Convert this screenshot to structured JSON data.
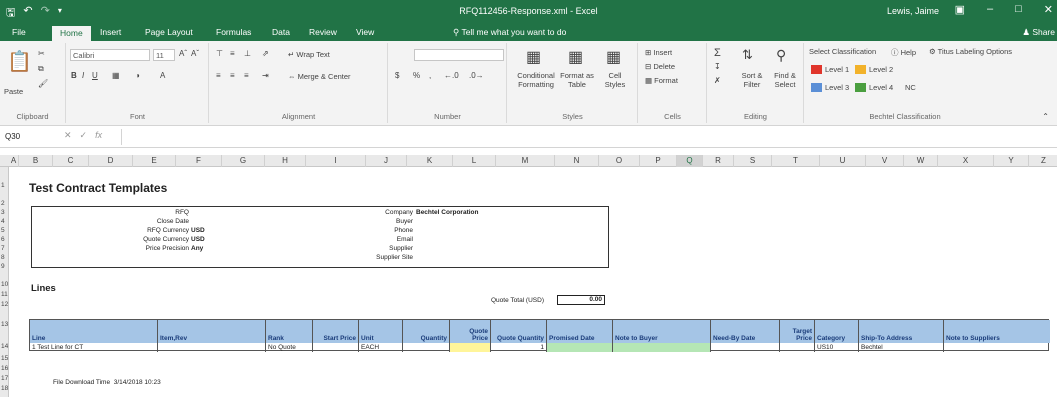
{
  "window": {
    "title": "RFQ112456-Response.xml - Excel",
    "user": "Lewis, Jaime",
    "qat_icons": [
      "save-icon",
      "undo-icon",
      "redo-icon",
      "customize-qat-icon"
    ],
    "controls": [
      "ribbon-display-icon",
      "minimize-icon",
      "maximize-icon",
      "close-icon"
    ]
  },
  "tabs": [
    "File",
    "Home",
    "Insert",
    "Page Layout",
    "Formulas",
    "Data",
    "Review",
    "View"
  ],
  "active_tab": "Home",
  "tell_me": "Tell me what you want to do",
  "share": "Share",
  "ribbon": {
    "clipboard": {
      "label": "Clipboard",
      "paste": "Paste"
    },
    "font": {
      "label": "Font",
      "name": "Calibri",
      "size": "11"
    },
    "alignment": {
      "label": "Alignment",
      "wrap": "Wrap Text",
      "merge": "Merge & Center"
    },
    "number": {
      "label": "Number",
      "format": "",
      "currency": "$",
      "percent": "%",
      "comma": ","
    },
    "styles": {
      "label": "Styles",
      "conditional": "Conditional Formatting",
      "format_table": "Format as Table",
      "cell_styles": "Cell Styles"
    },
    "cells": {
      "label": "Cells",
      "insert": "Insert",
      "delete": "Delete",
      "format": "Format"
    },
    "editing": {
      "label": "Editing",
      "sort": "Sort & Filter",
      "find": "Find & Select"
    },
    "classification": {
      "label": "Bechtel Classification",
      "select": "Select Classification",
      "help": "Help",
      "titus": "Titus Labeling Options",
      "levels": [
        {
          "name": "Level 1",
          "color": "#e0352b"
        },
        {
          "name": "Level 2",
          "color": "#f2b22a"
        },
        {
          "name": "Level 3",
          "color": "#5b8fd6"
        },
        {
          "name": "Level 4",
          "color": "#4a9e3f"
        },
        {
          "name": "NC",
          "color": ""
        }
      ]
    }
  },
  "formula_bar": {
    "name_box": "Q30",
    "formula": ""
  },
  "columns": [
    "A",
    "B",
    "C",
    "D",
    "E",
    "F",
    "G",
    "H",
    "I",
    "J",
    "K",
    "L",
    "M",
    "N",
    "O",
    "P",
    "Q",
    "R",
    "S",
    "T",
    "U",
    "V",
    "W",
    "X",
    "Y",
    "Z"
  ],
  "selected_column": "Q",
  "rows": [
    "1",
    "2",
    "3",
    "4",
    "5",
    "6",
    "7",
    "8",
    "9",
    "10",
    "11",
    "12",
    "13",
    "14",
    "15",
    "16",
    "17",
    "18"
  ],
  "sheet": {
    "title": "Test Contract Templates",
    "header_left": [
      {
        "label": "RFQ",
        "value": ""
      },
      {
        "label": "Close Date",
        "value": ""
      },
      {
        "label": "RFQ Currency",
        "value": "USD"
      },
      {
        "label": "Quote Currency",
        "value": "USD"
      },
      {
        "label": "Price Precision",
        "value": "Any"
      }
    ],
    "header_right": [
      {
        "label": "Company",
        "value": "Bechtel Corporation"
      },
      {
        "label": "Buyer",
        "value": ""
      },
      {
        "label": "Phone",
        "value": ""
      },
      {
        "label": "Email",
        "value": ""
      },
      {
        "label": "Supplier",
        "value": ""
      },
      {
        "label": "Supplier Site",
        "value": ""
      }
    ],
    "lines_title": "Lines",
    "quote_total_label": "Quote Total (USD)",
    "quote_total_value": "0.00",
    "table_headers": [
      "Line",
      "Item,Rev",
      "Rank",
      "Start Price",
      "Unit",
      "Quantity",
      "Quote Price",
      "Quote Quantity",
      "Promised Date",
      "Note to Buyer",
      "Need-By Date",
      "Target Price",
      "Category",
      "Ship-To Address",
      "Note to Suppliers"
    ],
    "table_row": [
      "1 Test Line for CT",
      "",
      "No Quote",
      "",
      "EACH",
      "",
      "",
      "1",
      "",
      "",
      "",
      "",
      "US10",
      "Bechtel",
      ""
    ],
    "download_label": "File Download Time",
    "download_time": "3/14/2018 10:23"
  }
}
